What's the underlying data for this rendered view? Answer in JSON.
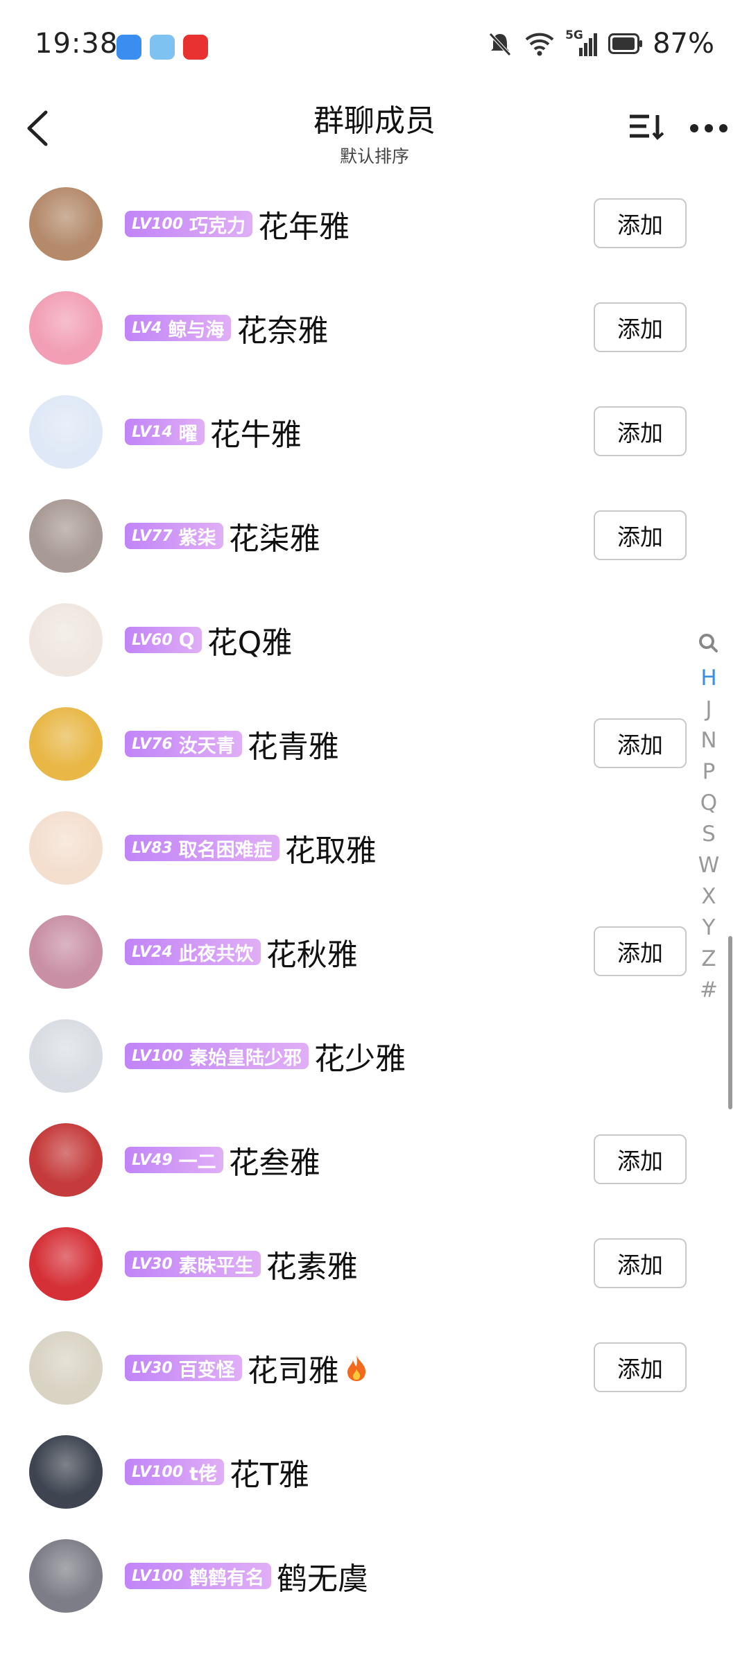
{
  "status_bar": {
    "time": "19:38",
    "network": "5G",
    "battery_percent": "87%"
  },
  "header": {
    "title": "群聊成员",
    "subtitle": "默认排序"
  },
  "index_bar": {
    "letters": [
      "H",
      "J",
      "N",
      "P",
      "Q",
      "S",
      "W",
      "X",
      "Y",
      "Z",
      "#"
    ],
    "active": "H"
  },
  "members": [
    {
      "level": "LV100",
      "title": "巧克力",
      "name": "花年雅",
      "add_label": "添加",
      "avatar_color": "#b48a6b"
    },
    {
      "level": "LV4",
      "title": "鲸与海",
      "name": "花奈雅",
      "add_label": "添加",
      "avatar_color": "#f29fb5"
    },
    {
      "level": "LV14",
      "title": "曜",
      "name": "花牛雅",
      "add_label": "添加",
      "avatar_color": "#dfe8f6"
    },
    {
      "level": "LV77",
      "title": "紫柒",
      "name": "花柒雅",
      "add_label": "添加",
      "avatar_color": "#a89a94"
    },
    {
      "level": "LV60",
      "title": "Q",
      "name": "花Q雅",
      "add_label": "",
      "avatar_color": "#efe6df"
    },
    {
      "level": "LV76",
      "title": "汝天青",
      "name": "花青雅",
      "add_label": "添加",
      "avatar_color": "#e8b746"
    },
    {
      "level": "LV83",
      "title": "取名困难症",
      "name": "花取雅",
      "add_label": "",
      "avatar_color": "#f4dfcf"
    },
    {
      "level": "LV24",
      "title": "此夜共饮",
      "name": "花秋雅",
      "add_label": "添加",
      "avatar_color": "#c990a5"
    },
    {
      "level": "LV100",
      "title": "秦始皇陆少邪",
      "name": "花少雅",
      "add_label": "",
      "avatar_color": "#d9dde3"
    },
    {
      "level": "LV49",
      "title": "一二",
      "name": "花叁雅",
      "add_label": "添加",
      "avatar_color": "#c53a3a"
    },
    {
      "level": "LV30",
      "title": "素昧平生",
      "name": "花素雅",
      "add_label": "添加",
      "avatar_color": "#d53037"
    },
    {
      "level": "LV30",
      "title": "百变怪",
      "name": "花司雅",
      "add_label": "添加",
      "avatar_color": "#d9d3c4",
      "fire": true
    },
    {
      "level": "LV100",
      "title": "t佬",
      "name": "花T雅",
      "add_label": "",
      "avatar_color": "#3e4550"
    },
    {
      "level": "LV100",
      "title": "鹤鹤有名",
      "name": "鹤无虞",
      "add_label": "",
      "avatar_color": "#7d7d87"
    }
  ]
}
